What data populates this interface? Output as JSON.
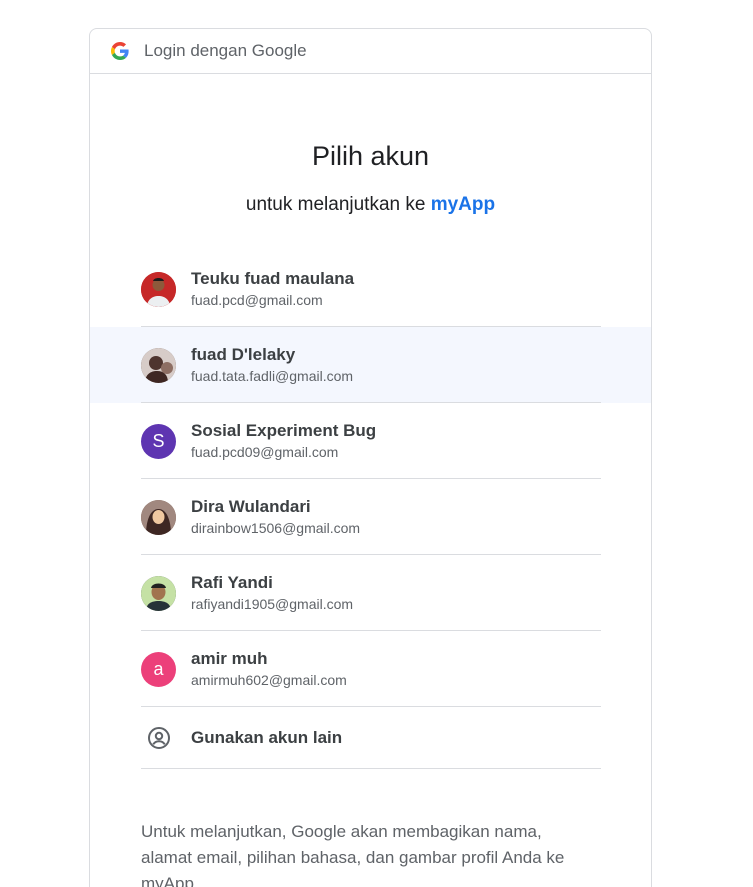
{
  "header": {
    "title": "Login dengan Google"
  },
  "main": {
    "title": "Pilih akun",
    "subtitle_prefix": "untuk melanjutkan ke",
    "app_name": "myApp"
  },
  "accounts": [
    {
      "name": "Teuku fuad maulana",
      "email": "fuad.pcd@gmail.com",
      "avatar_type": "photo",
      "avatar_color": "#c62828"
    },
    {
      "name": "fuad D'lelaky",
      "email": "fuad.tata.fadli@gmail.com",
      "avatar_type": "photo",
      "avatar_color": "#5d4e45"
    },
    {
      "name": "Sosial Experiment Bug",
      "email": "fuad.pcd09@gmail.com",
      "avatar_type": "letter",
      "initial": "S",
      "avatar_color": "#5e35b1"
    },
    {
      "name": "Dira Wulandari",
      "email": "dirainbow1506@gmail.com",
      "avatar_type": "photo",
      "avatar_color": "#6d4c41"
    },
    {
      "name": "Rafi Yandi",
      "email": "rafiyandi1905@gmail.com",
      "avatar_type": "photo",
      "avatar_color": "#37474f"
    },
    {
      "name": "amir muh",
      "email": "amirmuh602@gmail.com",
      "avatar_type": "letter",
      "initial": "a",
      "avatar_color": "#ec407a"
    }
  ],
  "other_account": {
    "label": "Gunakan akun lain",
    "icon": "account-circle-icon"
  },
  "footer": {
    "text": "Untuk melanjutkan, Google akan membagikan nama, alamat email, pilihan bahasa, dan gambar profil Anda ke myApp."
  },
  "colors": {
    "accent": "#1a73e8",
    "highlight_row": "#f4f7fe",
    "divider": "#dadce0"
  }
}
